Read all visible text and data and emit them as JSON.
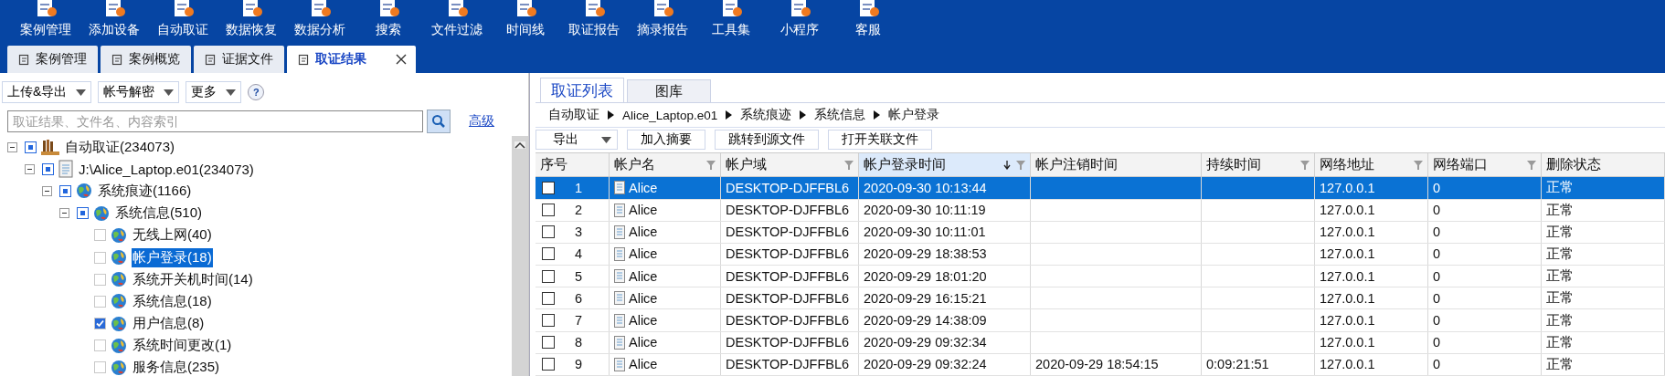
{
  "toolbar": [
    {
      "label": "案例管理"
    },
    {
      "label": "添加设备"
    },
    {
      "label": "自动取证"
    },
    {
      "label": "数据恢复"
    },
    {
      "label": "数据分析"
    },
    {
      "label": "搜索"
    },
    {
      "label": "文件过滤"
    },
    {
      "label": "时间线"
    },
    {
      "label": "取证报告"
    },
    {
      "label": "摘录报告"
    },
    {
      "label": "工具集"
    },
    {
      "label": "小程序"
    },
    {
      "label": "客服"
    }
  ],
  "tabs": [
    {
      "label": "案例管理",
      "selected": false,
      "closable": false
    },
    {
      "label": "案例概览",
      "selected": false,
      "closable": false
    },
    {
      "label": "证据文件",
      "selected": false,
      "closable": false
    },
    {
      "label": "取证结果",
      "selected": true,
      "closable": true
    }
  ],
  "left_panel": {
    "menus": [
      {
        "label": "上传&导出"
      },
      {
        "label": "帐号解密"
      },
      {
        "label": "更多"
      }
    ],
    "help": "?",
    "search": {
      "placeholder": "取证结果、文件名、内容索引"
    },
    "advanced_link": "高级",
    "tree": [
      {
        "label": "自动取证(234073)",
        "kind": "case",
        "checked": false,
        "partial": true,
        "expanded": true,
        "selected": false,
        "children": [
          {
            "label": "J:\\Alice_Laptop.e01(234073)",
            "kind": "image",
            "checked": false,
            "partial": true,
            "expanded": true,
            "selected": false,
            "children": [
              {
                "label": "系统痕迹(1166)",
                "kind": "category",
                "checked": false,
                "partial": true,
                "expanded": true,
                "selected": false,
                "children": [
                  {
                    "label": "系统信息(510)",
                    "kind": "category",
                    "checked": false,
                    "partial": true,
                    "expanded": true,
                    "selected": false,
                    "children": [
                      {
                        "label": "无线上网(40)",
                        "kind": "category",
                        "checked": false,
                        "partial": false,
                        "selected": false
                      },
                      {
                        "label": "帐户登录(18)",
                        "kind": "category",
                        "checked": false,
                        "partial": false,
                        "selected": true
                      },
                      {
                        "label": "系统开关机时间(14)",
                        "kind": "category",
                        "checked": false,
                        "partial": false,
                        "selected": false
                      },
                      {
                        "label": "系统信息(18)",
                        "kind": "category",
                        "checked": false,
                        "partial": false,
                        "selected": false
                      },
                      {
                        "label": "用户信息(8)",
                        "kind": "category",
                        "checked": true,
                        "partial": false,
                        "selected": false
                      },
                      {
                        "label": "系统时间更改(1)",
                        "kind": "category",
                        "checked": false,
                        "partial": false,
                        "selected": false
                      },
                      {
                        "label": "服务信息(235)",
                        "kind": "category",
                        "checked": false,
                        "partial": false,
                        "selected": false
                      }
                    ]
                  }
                ]
              }
            ]
          }
        ]
      }
    ]
  },
  "right_panel": {
    "tabs": [
      {
        "label": "取证列表",
        "selected": true
      },
      {
        "label": "图库",
        "selected": false
      }
    ],
    "breadcrumb": [
      "自动取证",
      "Alice_Laptop.e01",
      "系统痕迹",
      "系统信息",
      "帐户登录"
    ],
    "actions": [
      {
        "label": "导出",
        "kind": "dropdown"
      },
      {
        "label": "加入摘要",
        "kind": "button"
      },
      {
        "label": "跳转到源文件",
        "kind": "button"
      },
      {
        "label": "打开关联文件",
        "kind": "button"
      }
    ],
    "table": {
      "columns": [
        {
          "label": "序号",
          "filter": false,
          "sorted": false
        },
        {
          "label": "帐户名",
          "filter": true,
          "sorted": false
        },
        {
          "label": "帐户域",
          "filter": true,
          "sorted": false
        },
        {
          "label": "帐户登录时间",
          "filter": true,
          "sorted": true
        },
        {
          "label": "帐户注销时间",
          "filter": false,
          "sorted": false
        },
        {
          "label": "持续时间",
          "filter": true,
          "sorted": false
        },
        {
          "label": "网络地址",
          "filter": true,
          "sorted": false
        },
        {
          "label": "网络端口",
          "filter": true,
          "sorted": false
        },
        {
          "label": "删除状态",
          "filter": false,
          "sorted": false
        }
      ],
      "rows": [
        {
          "selected": true,
          "checked": false,
          "no": "1",
          "name": "Alice",
          "domain": "DESKTOP-DJFFBL6",
          "login": "2020-09-30 10:13:44",
          "ip": "127.0.0.1",
          "port": "0",
          "status": "正常"
        },
        {
          "selected": false,
          "checked": false,
          "no": "2",
          "name": "Alice",
          "domain": "DESKTOP-DJFFBL6",
          "login": "2020-09-30 10:11:19",
          "ip": "127.0.0.1",
          "port": "0",
          "status": "正常"
        },
        {
          "selected": false,
          "checked": false,
          "no": "3",
          "name": "Alice",
          "domain": "DESKTOP-DJFFBL6",
          "login": "2020-09-30 10:11:01",
          "ip": "127.0.0.1",
          "port": "0",
          "status": "正常"
        },
        {
          "selected": false,
          "checked": false,
          "no": "4",
          "name": "Alice",
          "domain": "DESKTOP-DJFFBL6",
          "login": "2020-09-29 18:38:53",
          "ip": "127.0.0.1",
          "port": "0",
          "status": "正常"
        },
        {
          "selected": false,
          "checked": false,
          "no": "5",
          "name": "Alice",
          "domain": "DESKTOP-DJFFBL6",
          "login": "2020-09-29 18:01:20",
          "ip": "127.0.0.1",
          "port": "0",
          "status": "正常"
        },
        {
          "selected": false,
          "checked": false,
          "no": "6",
          "name": "Alice",
          "domain": "DESKTOP-DJFFBL6",
          "login": "2020-09-29 16:15:21",
          "ip": "127.0.0.1",
          "port": "0",
          "status": "正常"
        },
        {
          "selected": false,
          "checked": false,
          "no": "7",
          "name": "Alice",
          "domain": "DESKTOP-DJFFBL6",
          "login": "2020-09-29 14:38:09",
          "ip": "127.0.0.1",
          "port": "0",
          "status": "正常"
        },
        {
          "selected": false,
          "checked": false,
          "no": "8",
          "name": "Alice",
          "domain": "DESKTOP-DJFFBL6",
          "login": "2020-09-29 09:32:34",
          "ip": "127.0.0.1",
          "port": "0",
          "status": "正常"
        },
        {
          "selected": false,
          "checked": false,
          "no": "9",
          "name": "Alice",
          "domain": "DESKTOP-DJFFBL6",
          "login": "2020-09-29 09:32:24",
          "logout": "2020-09-29 18:54:15",
          "duration": "0:09:21:51",
          "ip": "127.0.0.1",
          "port": "0",
          "status": "正常"
        }
      ]
    }
  }
}
